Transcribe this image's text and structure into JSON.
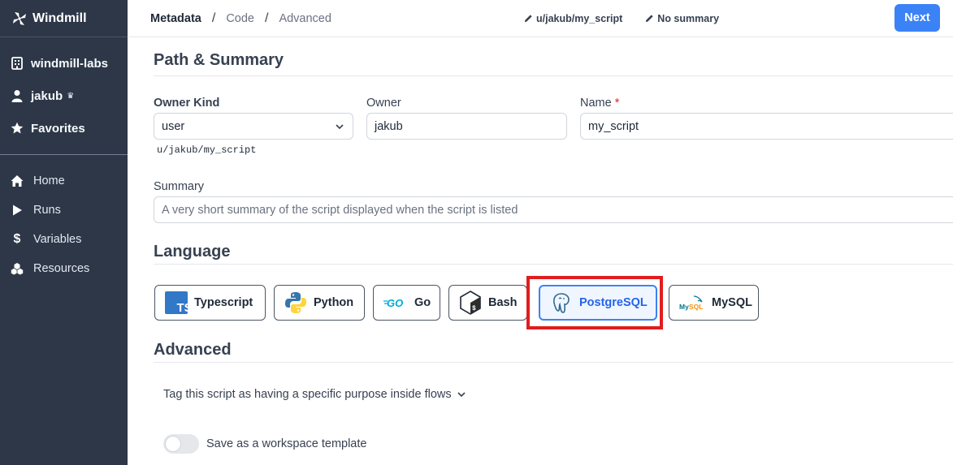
{
  "app": {
    "brand": "Windmill"
  },
  "sidebar": {
    "workspace_items": [
      {
        "label": "windmill-labs",
        "icon": "building-icon"
      },
      {
        "label": "jakub",
        "icon": "user-icon",
        "badge": "crown-icon"
      },
      {
        "label": "Favorites",
        "icon": "star-icon"
      }
    ],
    "nav_items": [
      {
        "label": "Home",
        "icon": "home-icon"
      },
      {
        "label": "Runs",
        "icon": "play-icon"
      },
      {
        "label": "Variables",
        "icon": "dollar-icon"
      },
      {
        "label": "Resources",
        "icon": "cubes-icon"
      }
    ]
  },
  "header": {
    "breadcrumbs": [
      "Metadata",
      "Code",
      "Advanced"
    ],
    "separator": "/",
    "script_path": "u/jakub/my_script",
    "summary_status": "No summary",
    "next_label": "Next"
  },
  "path_summary": {
    "title": "Path & Summary",
    "owner_kind_label": "Owner Kind",
    "owner_kind_value": "user",
    "owner_label": "Owner",
    "owner_value": "jakub",
    "name_label": "Name",
    "name_required_mark": "*",
    "name_value": "my_script",
    "path_hint": "u/jakub/my_script",
    "summary_label": "Summary",
    "summary_placeholder": "A very short summary of the script displayed when the script is listed"
  },
  "language": {
    "title": "Language",
    "options": [
      {
        "label": "Typescript",
        "icon": "typescript-icon"
      },
      {
        "label": "Python",
        "icon": "python-icon"
      },
      {
        "label": "Go",
        "icon": "go-icon"
      },
      {
        "label": "Bash",
        "icon": "bash-icon"
      },
      {
        "label": "PostgreSQL",
        "icon": "postgresql-icon",
        "selected": true
      },
      {
        "label": "MySQL",
        "icon": "mysql-icon"
      }
    ],
    "selected": "PostgreSQL",
    "highlight_color": "#e11d1d"
  },
  "advanced": {
    "title": "Advanced",
    "tag_toggle_label": "Tag this script as having a specific purpose inside flows",
    "template_switch_label": "Save as a workspace template",
    "template_switch_on": false
  },
  "colors": {
    "sidebar_bg": "#2d3748",
    "accent": "#3b82f6"
  }
}
